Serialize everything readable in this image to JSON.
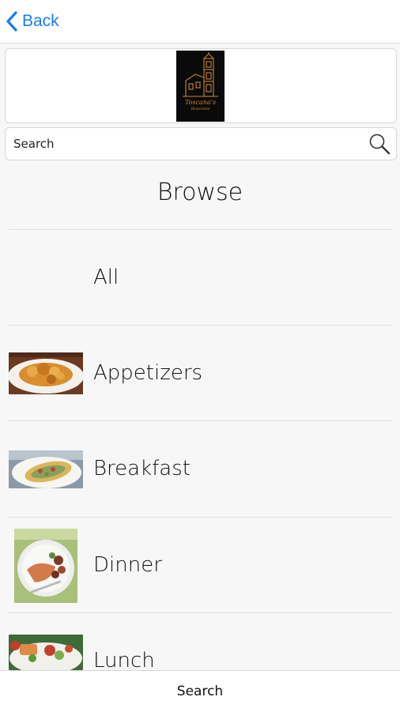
{
  "nav": {
    "back_label": "Back"
  },
  "logo": {
    "name": "Toscana's",
    "subtitle": "Ristorante"
  },
  "search": {
    "placeholder": "Search"
  },
  "browse": {
    "title": "Browse",
    "categories": [
      {
        "label": "All"
      },
      {
        "label": "Appetizers",
        "image": "appetizers-photo"
      },
      {
        "label": "Breakfast",
        "image": "breakfast-photo"
      },
      {
        "label": "Dinner",
        "image": "dinner-photo"
      },
      {
        "label": "Lunch",
        "image": "lunch-photo"
      }
    ]
  },
  "bottom_bar": {
    "search_label": "Search"
  },
  "colors": {
    "accent": "#1a7cf2",
    "logo_gold": "#c9852a"
  }
}
